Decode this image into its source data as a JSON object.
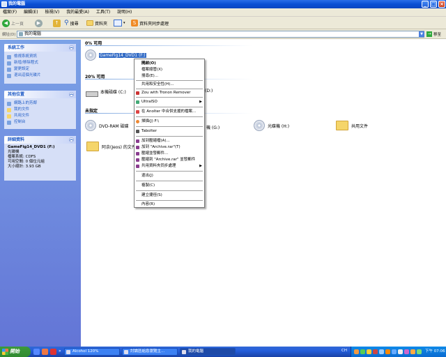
{
  "window": {
    "title": "我的電腦"
  },
  "menubar": [
    "檔案(F)",
    "編輯(E)",
    "檢視(V)",
    "我的最愛(A)",
    "工具(T)",
    "說明(H)"
  ],
  "toolbar": {
    "back": "上一頁",
    "search": "搜尋",
    "folders": "資料夾",
    "sync": "資料夾同步處理"
  },
  "address": {
    "label": "網址(D)",
    "value": "我的電腦",
    "go": "移至"
  },
  "sidebar": {
    "system_tasks": {
      "title": "系統工作",
      "items": [
        "檢視系統資訊",
        "新增/移除程式",
        "變更設定",
        "退出這個光碟片"
      ]
    },
    "other_places": {
      "title": "其他位置",
      "items": [
        "網路上的芳鄰",
        "我的文件",
        "共用文件",
        "控制台"
      ]
    },
    "details": {
      "title": "詳細資料",
      "name": "GameFig14_DVD1 (F:)",
      "type": "光碟機",
      "fs": "檔案系統: CDFS",
      "free": "可用空間: 0 個位元組",
      "size": "大小總計: 3.93 GB"
    }
  },
  "content": {
    "groups": [
      "0% 可用",
      "20% 可用",
      "未指定"
    ],
    "items": {
      "cd_f": "GameFig14_DVD1 (F:)",
      "c_drive": "本機磁碟 (C:)",
      "d_drive": "(D:)",
      "dvd_ram": "DVD-RAM 磁碟",
      "g_drive": "機 (G:)",
      "h_drive": "光碟機 (H:)",
      "shared": "共用文件",
      "user_docs": "阿余(Jeos) 的文件"
    }
  },
  "context_menu": [
    "開啟(O)",
    "檔案總管(X)",
    "搜尋(E)...",
    "共用和安全性(H)...",
    "Zou with Tronon Remover",
    "UltraISO",
    "在 Anolter 中合併支援的檔案...",
    "掃描(J) F:\\",
    "Tabolter",
    "加到壓縮檔(A)...",
    "加到 \"Archive.rar\"(T)",
    "壓縮並發郵件...",
    "壓縮到 \"Archive.rar\" 並發郵件",
    "共用資料夾同步處理",
    "退出(J)",
    "複製(C)",
    "建立捷徑(S)",
    "內容(R)"
  ],
  "taskbar": {
    "start": "開始",
    "tasks": [
      "Alcohol 120%",
      "討論區組息瀏覽主...",
      "我的電腦"
    ],
    "time": "下午 07:06"
  },
  "colors": {
    "taskbar": "#245edb",
    "start": "#2f8a2f",
    "sidebar": "#6375d6",
    "selection": "#316ac5"
  }
}
